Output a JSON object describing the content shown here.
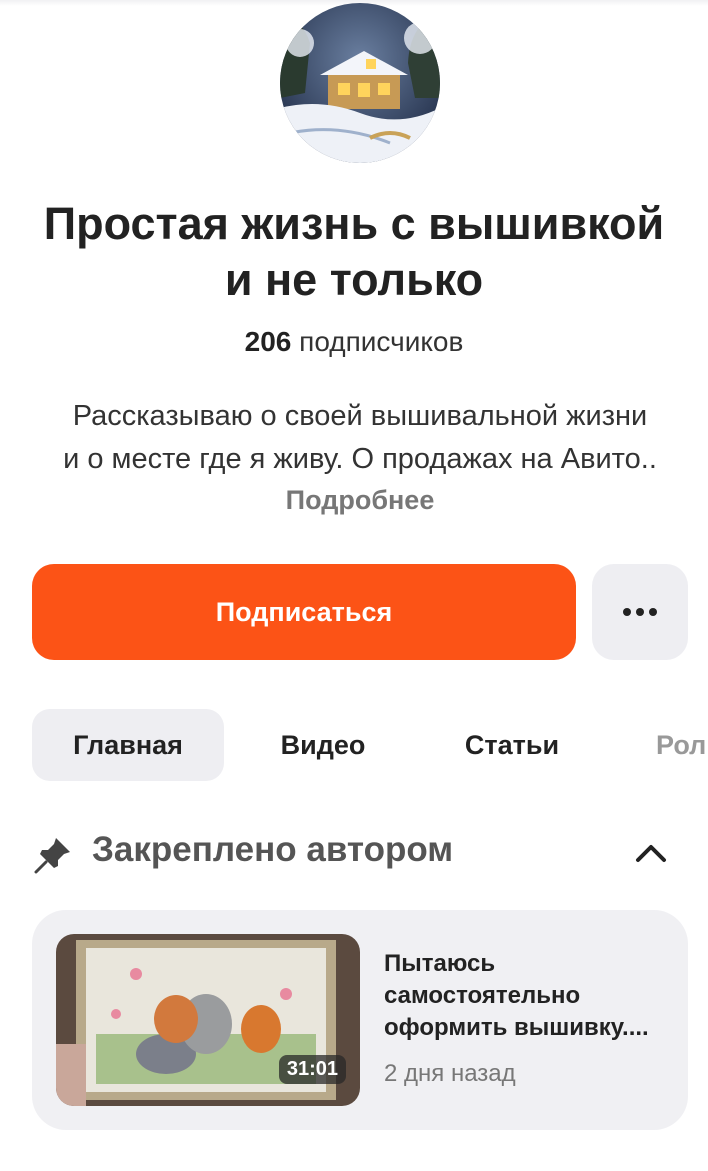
{
  "channel": {
    "title_line1": "Простая жизнь с вышивкой",
    "title_line2": "и не только",
    "subscribers_count": "206",
    "subscribers_label": "подписчиков",
    "description_line1": "Рассказываю о своей вышивальной жизни",
    "description_line2": "и о месте где я живу. О продажах на Авито..",
    "more_label": "Подробнее"
  },
  "actions": {
    "subscribe_label": "Подписаться",
    "menu_icon": "more-dots-icon"
  },
  "tabs": [
    {
      "label": "Главная",
      "active": true
    },
    {
      "label": "Видео",
      "active": false
    },
    {
      "label": "Статьи",
      "active": false
    },
    {
      "label": "Ролики",
      "active": false
    }
  ],
  "pinned": {
    "label": "Закреплено автором",
    "icon": "pin-icon",
    "toggle_icon": "chevron-up-icon",
    "video": {
      "title_line1": "Пытаюсь",
      "title_line2": "самостоятельно",
      "title_line3": "оформить вышивку....",
      "duration": "31:01",
      "date": "2 дня назад"
    }
  },
  "colors": {
    "accent": "#fc5316",
    "chip_bg": "#eeeef2",
    "card_bg": "#f0f0f3"
  }
}
